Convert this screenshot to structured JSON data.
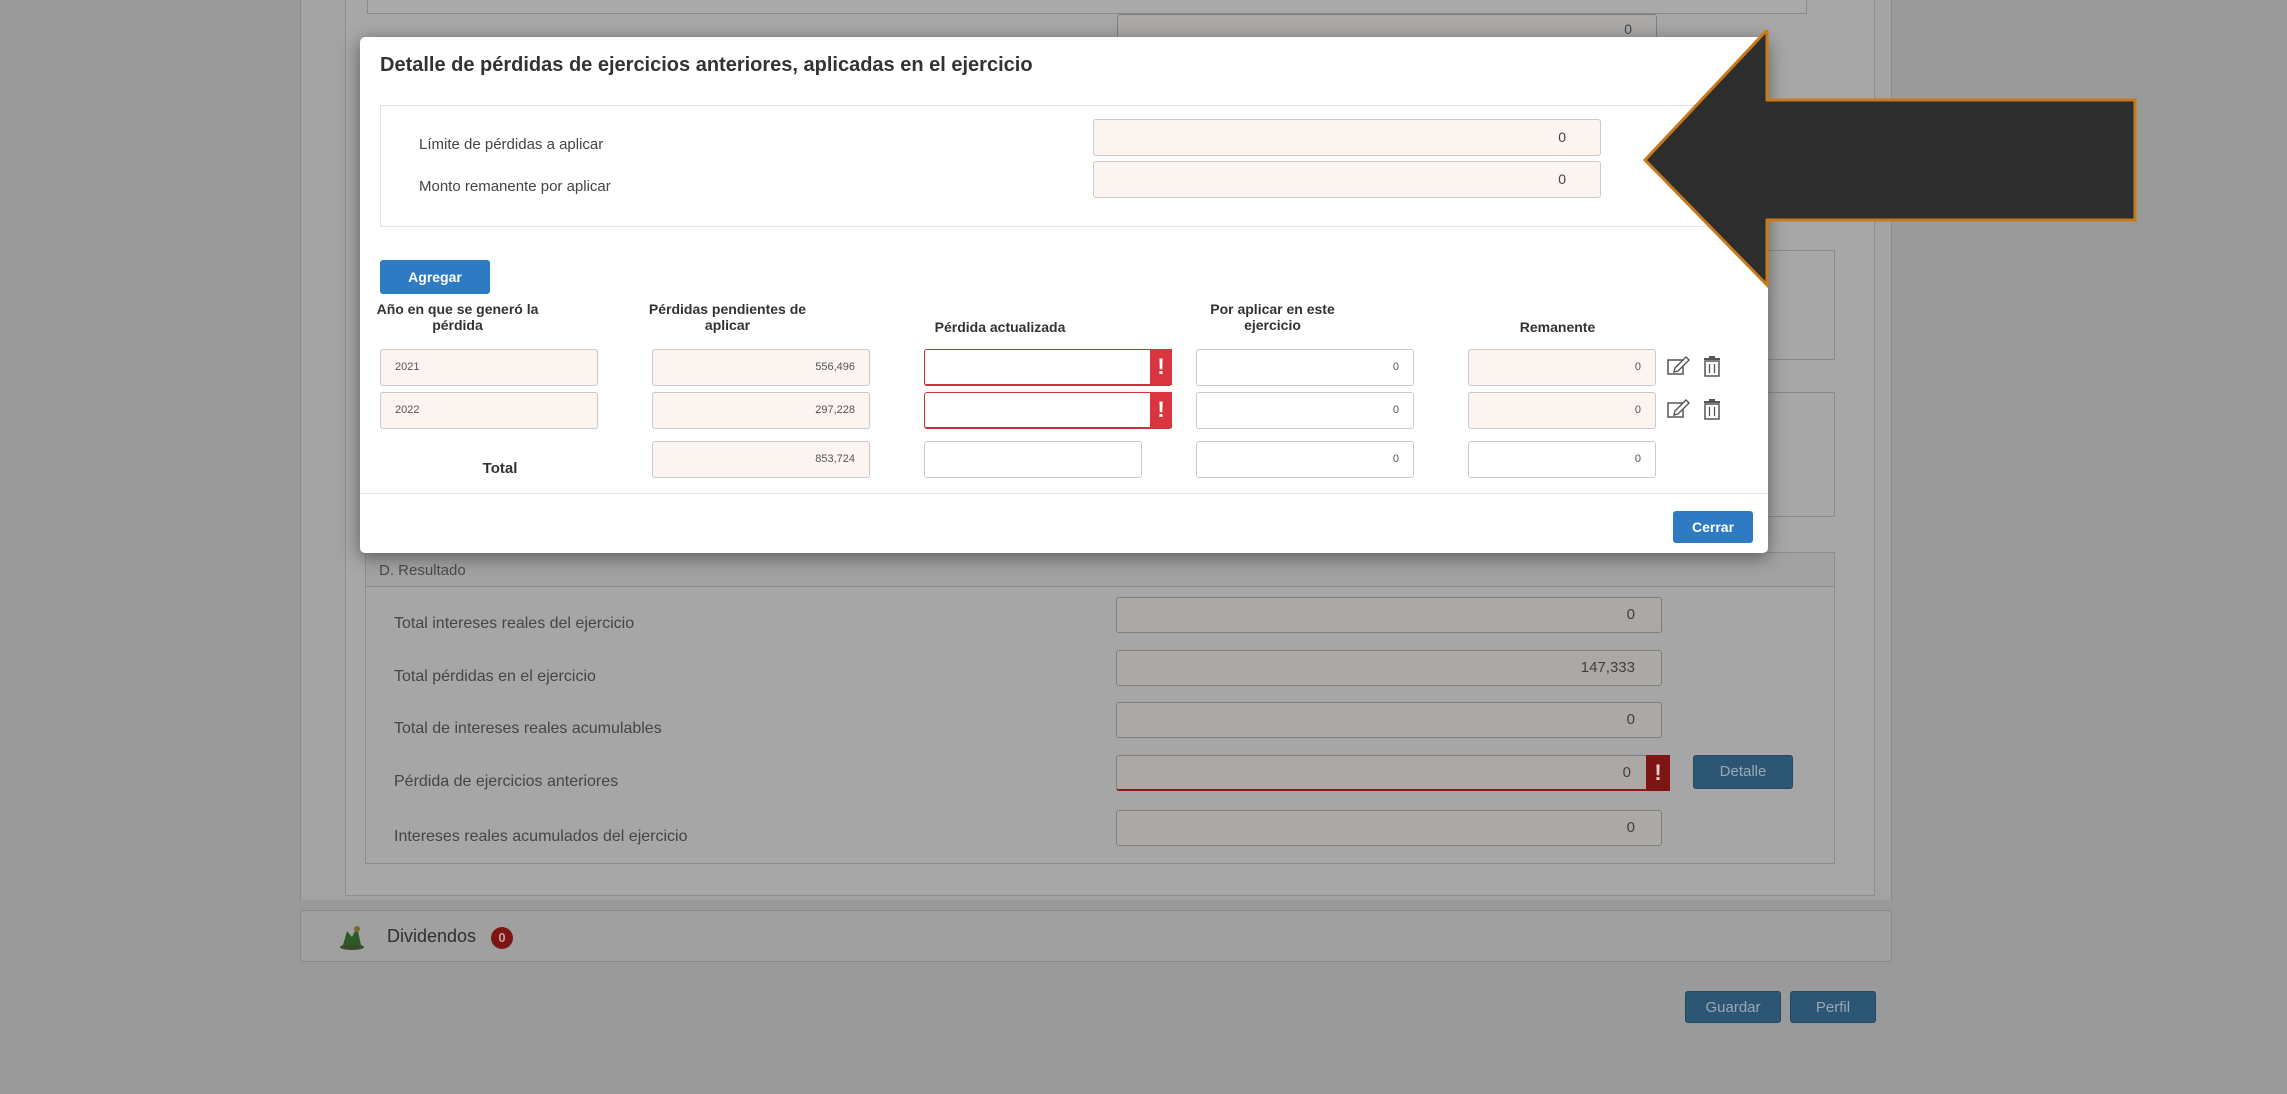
{
  "modal": {
    "title": "Detalle de pérdidas de ejercicios anteriores, aplicadas en el ejercicio",
    "limits": [
      {
        "label": "Límite de pérdidas a aplicar",
        "value": "0"
      },
      {
        "label": "Monto remanente por aplicar",
        "value": "0"
      }
    ],
    "add_label": "Agregar",
    "columns": [
      "Año en que se generó la pérdida",
      "Pérdidas pendientes de aplicar",
      "Pérdida actualizada",
      "Por aplicar en este ejercicio",
      "Remanente"
    ],
    "rows": [
      {
        "year": "2021",
        "pending": "556,496",
        "updated": "",
        "apply": "0",
        "remaining": "0"
      },
      {
        "year": "2022",
        "pending": "297,228",
        "updated": "",
        "apply": "0",
        "remaining": "0"
      }
    ],
    "totals": {
      "label": "Total",
      "pending": "853,724",
      "updated": "",
      "apply": "0",
      "remaining": "0"
    },
    "error_mark": "!",
    "close_label": "Cerrar"
  },
  "background": {
    "top_value": "0",
    "section_title": "D. Resultado",
    "rows": [
      {
        "label": "Total intereses reales del ejercicio",
        "value": "0"
      },
      {
        "label": "Total pérdidas en el ejercicio",
        "value": "147,333"
      },
      {
        "label": "Total de intereses reales acumulables",
        "value": "0"
      },
      {
        "label": "Pérdida de ejercicios anteriores",
        "value": "0"
      },
      {
        "label": "Intereses reales acumulados del ejercicio",
        "value": "0"
      }
    ],
    "detail_label": "Detalle",
    "dividends_label": "Dividendos",
    "dividends_badge": "0",
    "save_label": "Guardar",
    "profile_label": "Perfil"
  },
  "colors": {
    "accent": "#2e7bc4",
    "error": "#d9353e",
    "arrow_fill": "#2d2d2d",
    "arrow_stroke": "#c8791e"
  }
}
